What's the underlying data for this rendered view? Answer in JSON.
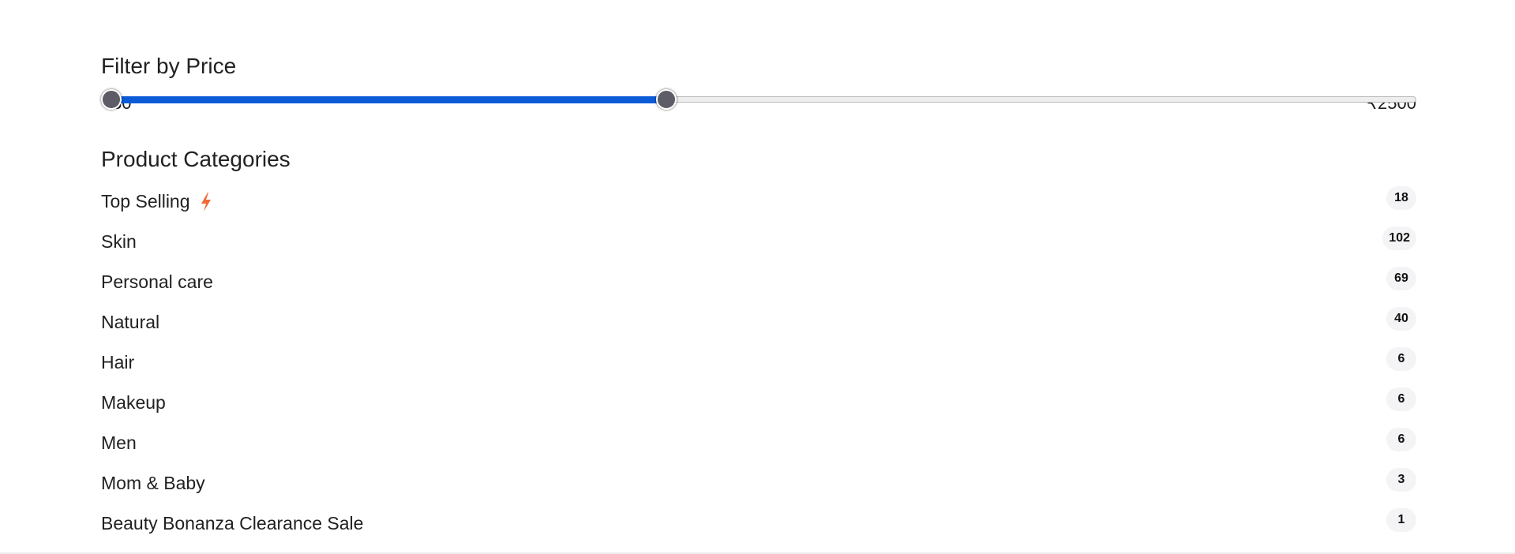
{
  "price_filter": {
    "title": "Filter by Price",
    "min_label": "₹30",
    "max_label": "₹2500",
    "range_fraction": {
      "low": 0.0,
      "high": 0.43
    },
    "accent_color": "#0b5bd7"
  },
  "categories": {
    "title": "Product Categories",
    "items": [
      {
        "name": "Top Selling",
        "count": "18",
        "icon": "lightning-bolt-icon"
      },
      {
        "name": "Skin",
        "count": "102"
      },
      {
        "name": "Personal care",
        "count": "69"
      },
      {
        "name": "Natural",
        "count": "40"
      },
      {
        "name": "Hair",
        "count": "6"
      },
      {
        "name": "Makeup",
        "count": "6"
      },
      {
        "name": "Men",
        "count": "6"
      },
      {
        "name": "Mom & Baby",
        "count": "3"
      },
      {
        "name": "Beauty Bonanza Clearance Sale",
        "count": "1"
      }
    ],
    "bolt_color": "#f26a35"
  }
}
